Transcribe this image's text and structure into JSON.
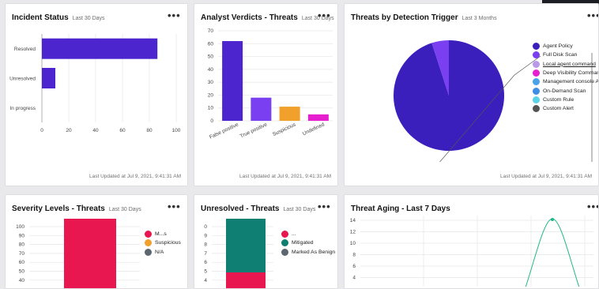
{
  "cards": {
    "incident_status": {
      "title": "Incident Status",
      "subtitle": "Last 30 Days",
      "menu": "•••",
      "updated": "Last Updated at Jul 9, 2021, 9:41:31 AM",
      "chart_data": {
        "type": "bar",
        "orientation": "horizontal",
        "categories": [
          "Resolved",
          "Unresolved",
          "In progress"
        ],
        "values": [
          86,
          10,
          0
        ],
        "xlim": [
          0,
          100
        ],
        "xticks": [
          "0",
          "20",
          "40",
          "60",
          "80",
          "100"
        ],
        "color": "#4d25cf"
      }
    },
    "analyst_verdicts": {
      "title": "Analyst Verdicts - Threats",
      "subtitle": "Last 30 Days",
      "menu": "•••",
      "updated": "Last Updated at Jul 9, 2021, 9:41:31 AM",
      "chart_data": {
        "type": "bar",
        "categories": [
          "False positive",
          "True positive",
          "Suspicious",
          "Undefined"
        ],
        "values": [
          62,
          18,
          11,
          5
        ],
        "ylim": [
          0,
          70
        ],
        "yticks": [
          "0",
          "10",
          "20",
          "30",
          "40",
          "50",
          "60",
          "70"
        ],
        "colors": [
          "#4d25cf",
          "#7a3ff0",
          "#f0a02b",
          "#e61fcf"
        ]
      }
    },
    "detection_trigger": {
      "title": "Threats by Detection Trigger",
      "subtitle": "Last 3 Months",
      "menu": "•••",
      "updated": "Last Updated at Jul 9, 2021, 9:41:31 AM",
      "chart_data": {
        "type": "pie",
        "labels": [
          "Agent Policy",
          "Full Disk Scan",
          "Local agent command",
          "Deep Visibility Command",
          "Management console API",
          "On-Demand Scan",
          "Custom Rule",
          "Custom Alert"
        ],
        "values": [
          95,
          5,
          0,
          0,
          0,
          0,
          0,
          0
        ],
        "colors": [
          "#3a1fbd",
          "#7a3ff0",
          "#b89ae8",
          "#e61fcf",
          "#4aa3e8",
          "#3f8ee3",
          "#5ad3e6",
          "#545454"
        ]
      }
    },
    "severity_levels": {
      "title": "Severity Levels - Threats",
      "subtitle": "Last 30 Days",
      "menu": "•••",
      "legend": [
        {
          "label": "M...s",
          "color": "#e8174f"
        },
        {
          "label": "Suspicious",
          "color": "#f0a02b"
        },
        {
          "label": "N/A",
          "color": "#5b6670"
        }
      ],
      "chart_data": {
        "type": "bar",
        "yticks": [
          "100",
          "90",
          "80",
          "70",
          "60",
          "50",
          "40"
        ],
        "ylim": [
          40,
          100
        ],
        "color": "#e8174f"
      }
    },
    "unresolved_threats": {
      "title": "Unresolved - Threats",
      "subtitle": "Last 30 Days",
      "menu": "•••",
      "legend": [
        {
          "label": "...",
          "color": "#e8174f"
        },
        {
          "label": "Mitigated",
          "color": "#0f7f73"
        },
        {
          "label": "Marked As Benign",
          "color": "#5b6670"
        }
      ],
      "chart_data": {
        "type": "bar",
        "yticks": [
          "0",
          "9",
          "8",
          "7",
          "6",
          "5",
          "4"
        ],
        "colors": [
          "#0f7f73",
          "#e8174f"
        ]
      }
    },
    "threat_aging": {
      "title": "Threat Aging - Last 7 Days",
      "menu": "•••",
      "chart_data": {
        "type": "line",
        "yticks": [
          "14",
          "12",
          "10",
          "8",
          "6",
          "4"
        ],
        "color": "#20b68a"
      }
    }
  }
}
